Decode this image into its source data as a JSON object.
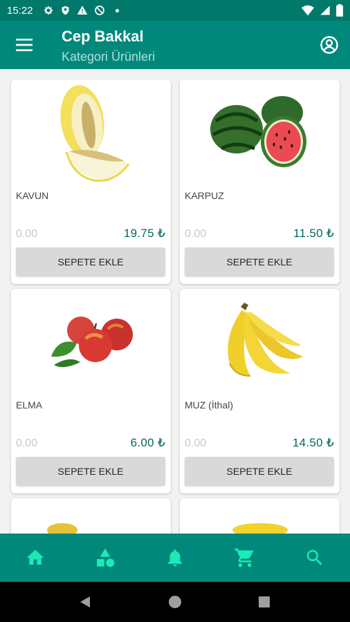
{
  "status_bar": {
    "time": "15:22",
    "icons": [
      "settings-icon",
      "shield-icon",
      "warning-icon",
      "no-data-icon",
      "dot-icon"
    ],
    "right_icons": [
      "wifi-icon",
      "signal-icon",
      "battery-icon"
    ]
  },
  "app_bar": {
    "title": "Cep Bakkal",
    "subtitle": "Kategori Ürünleri",
    "menu_icon": "hamburger-menu-icon",
    "profile_icon": "account-circle-icon"
  },
  "products": [
    {
      "name": "KAVUN",
      "old_price": "0.00",
      "price": "19.75 ₺",
      "button": "SEPETE EKLE",
      "image": "melon"
    },
    {
      "name": "KARPUZ",
      "old_price": "0.00",
      "price": "11.50 ₺",
      "button": "SEPETE EKLE",
      "image": "watermelon"
    },
    {
      "name": "ELMA",
      "old_price": "0.00",
      "price": "6.00 ₺",
      "button": "SEPETE EKLE",
      "image": "apples"
    },
    {
      "name": "MUZ (İthal)",
      "old_price": "0.00",
      "price": "14.50 ₺",
      "button": "SEPETE EKLE",
      "image": "bananas"
    }
  ],
  "bottom_nav": [
    "home-icon",
    "categories-icon",
    "notifications-icon",
    "cart-icon",
    "search-icon"
  ],
  "colors": {
    "primary": "#00897b",
    "primary_dark": "#00796b",
    "accent": "#1de9b6",
    "price": "#00695c"
  }
}
